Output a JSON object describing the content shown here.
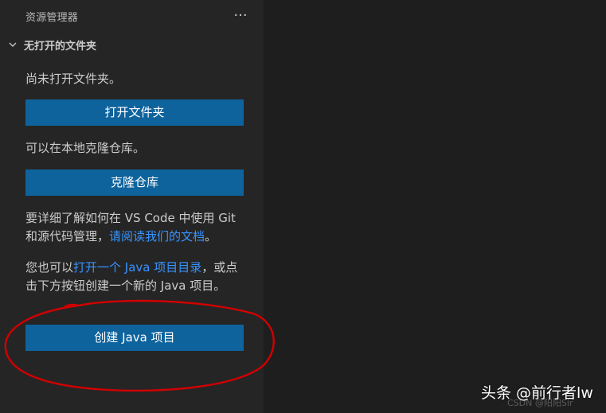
{
  "sidebar": {
    "title": "资源管理器",
    "more_actions": "···",
    "section": {
      "label": "无打开的文件夹"
    },
    "messages": {
      "no_folder": "尚未打开文件夹。",
      "clone_hint": "可以在本地克隆仓库。",
      "git_prefix": "要详细了解如何在 VS Code 中使用 Git 和源代码管理，",
      "git_link": "请阅读我们的文档",
      "git_suffix": "。",
      "java_prefix": "您也可以",
      "java_link": "打开一个 Java 项目目录",
      "java_suffix": "，或点击下方按钮创建一个新的 Java 项目。"
    },
    "buttons": {
      "open_folder": "打开文件夹",
      "clone_repo": "克隆仓库",
      "create_java": "创建 Java 项目"
    }
  },
  "watermark": {
    "text": "头条 @前行者lw",
    "faint": "CSDN @阳阳Sir"
  },
  "colors": {
    "sidebar_bg": "#252526",
    "editor_bg": "#1e1e1e",
    "button_bg": "#0e639c",
    "link": "#3794ff",
    "annotation": "#d10000"
  }
}
